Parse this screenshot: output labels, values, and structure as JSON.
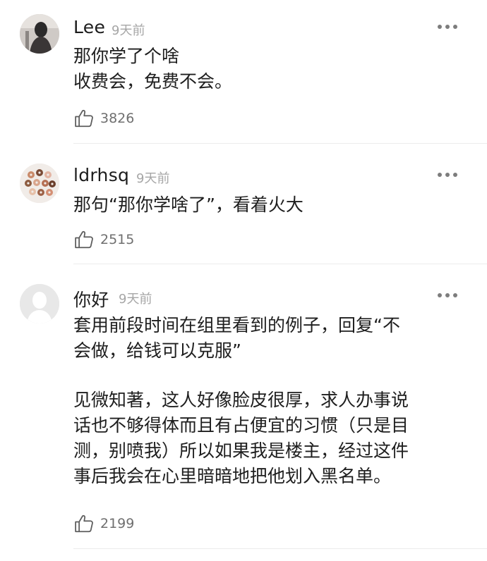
{
  "comments": [
    {
      "username": "Lee",
      "time": "9天前",
      "lines": [
        "那你学了个啥",
        "收费会，免费不会。"
      ],
      "likes": "3826"
    },
    {
      "username": "ldrhsq",
      "time": "9天前",
      "lines": [
        "那句“那你学啥了”，看着火大"
      ],
      "likes": "2515"
    },
    {
      "username": "你好",
      "time": "9天前",
      "lines": [
        "套用前段时间在组里看到的例子，回复“不",
        "会做，给钱可以克服”",
        "",
        "见微知著，这人好像脸皮很厚，求人办事说",
        "话也不够得体而且有占便宜的习惯（只是目",
        "测，别喷我）所以如果我是楼主，经过这件",
        "事后我会在心里暗暗地把他划入黑名单。"
      ],
      "likes": "2199"
    }
  ],
  "icons": {
    "like": "thumbs-up-icon",
    "more": "more-dots-icon",
    "avatar_default": "user-silhouette-icon"
  },
  "colors": {
    "text": "#1e1e1e",
    "meta": "#a6a6a6",
    "like_count": "#6f6f6f",
    "divider": "#ececec"
  }
}
